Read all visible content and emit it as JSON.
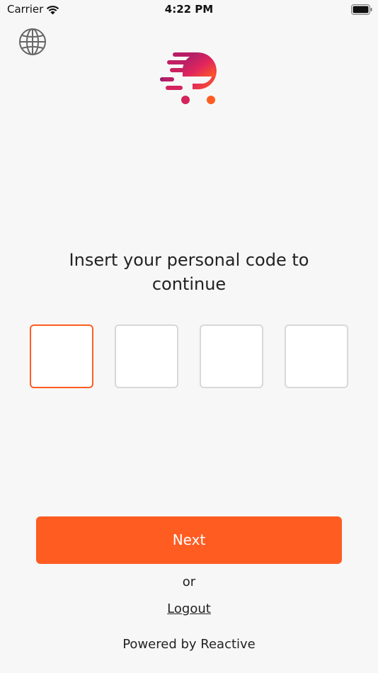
{
  "status_bar": {
    "carrier": "Carrier",
    "time": "4:22 PM"
  },
  "icons": {
    "language": "globe-icon",
    "logo": "brand-logo-icon"
  },
  "colors": {
    "accent": "#ff5c22",
    "background": "#f7f7f7",
    "box_border": "#d8d8d8",
    "logo_gradient_start": "#9c1f6b",
    "logo_gradient_end": "#ff5c22"
  },
  "prompt": {
    "line1": "Insert your personal code to",
    "line2": "continue"
  },
  "code_inputs": [
    {
      "value": "",
      "active": true
    },
    {
      "value": "",
      "active": false
    },
    {
      "value": "",
      "active": false
    },
    {
      "value": "",
      "active": false
    }
  ],
  "actions": {
    "next_label": "Next",
    "or_label": "or",
    "logout_label": "Logout"
  },
  "footer": {
    "powered_by": "Powered by Reactive"
  }
}
